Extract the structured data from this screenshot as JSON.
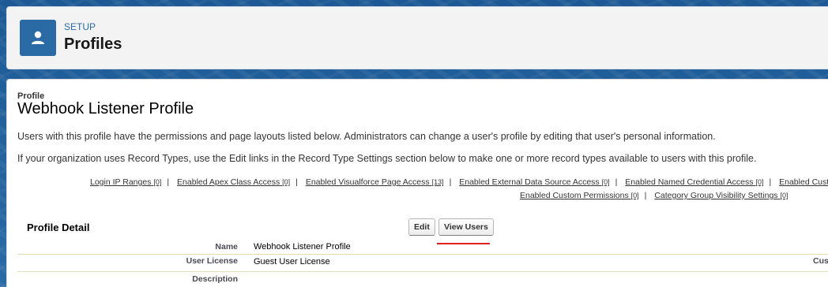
{
  "header": {
    "setup_label": "SETUP",
    "title": "Profiles",
    "icon": "user-icon"
  },
  "profile": {
    "type_label": "Profile",
    "name": "Webhook Listener Profile",
    "description1": "Users with this profile have the permissions and page layouts listed below. Administrators can change a user's profile by editing that user's personal information.",
    "description2": "If your organization uses Record Types, use the Edit links in the Record Type Settings section below to make one or more record types available to users with this profile."
  },
  "related_links": {
    "row1": [
      {
        "label": "Login IP Ranges",
        "count": "[0]"
      },
      {
        "label": "Enabled Apex Class Access",
        "count": "[0]"
      },
      {
        "label": "Enabled Visualforce Page Access",
        "count": "[13]"
      },
      {
        "label": "Enabled External Data Source Access",
        "count": "[0]"
      },
      {
        "label": "Enabled Named Credential Access",
        "count": "[0]"
      },
      {
        "label": "Enabled Custom",
        "count": ""
      }
    ],
    "row2": [
      {
        "label": "Enabled Custom Permissions",
        "count": "[0]"
      },
      {
        "label": "Category Group Visibility Settings",
        "count": "[0]"
      }
    ],
    "separator": "|"
  },
  "detail": {
    "title": "Profile Detail",
    "edit_label": "Edit",
    "view_users_label": "View Users",
    "fields": [
      {
        "label": "Name",
        "value": "Webhook Listener Profile"
      },
      {
        "label": "User License",
        "value": "Guest User License"
      },
      {
        "label": "Description",
        "value": ""
      }
    ],
    "cut_label": "Cus"
  },
  "colors": {
    "accent": "#2a6aa5",
    "highlight": "#e0201c"
  }
}
